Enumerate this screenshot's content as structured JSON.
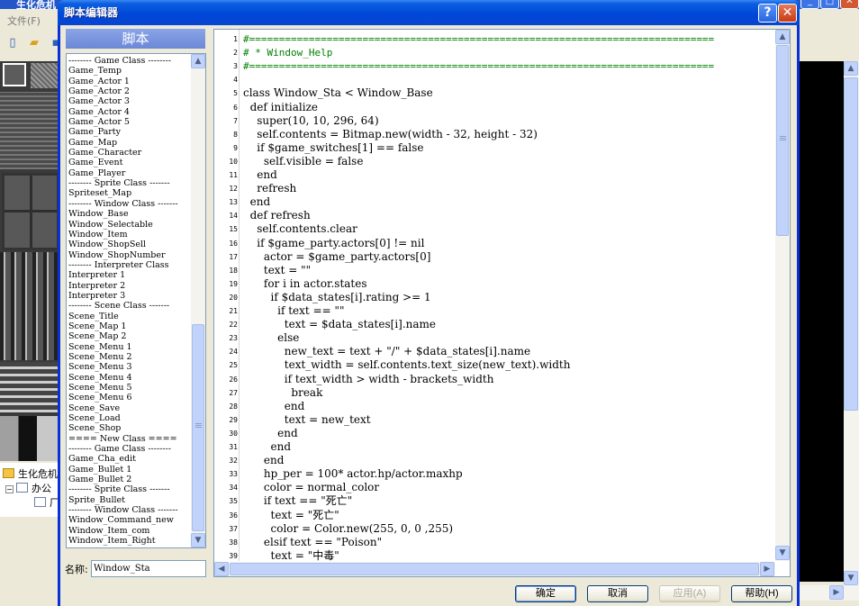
{
  "background_app": {
    "title": "生化危机",
    "menu": "文件(F)",
    "tree": [
      {
        "label": "生化危机"
      },
      {
        "label": "办公"
      },
      {
        "label": "厂"
      }
    ]
  },
  "dialog": {
    "title": "脚本编辑器",
    "help_glyph": "?",
    "close_glyph": "✕"
  },
  "script_panel": {
    "header": "脚本",
    "items": [
      "-------- Game Class --------",
      "Game_Temp",
      "Game_Actor 1",
      "Game_Actor 2",
      "Game_Actor 3",
      "Game_Actor 4",
      "Game_Actor 5",
      "Game_Party",
      "Game_Map",
      "Game_Character",
      "Game_Event",
      "Game_Player",
      "-------- Sprite Class -------",
      "Spriteset_Map",
      "-------- Window Class -------",
      "Window_Base",
      "Window_Selectable",
      "Window_Item",
      "Window_ShopSell",
      "Window_ShopNumber",
      "-------- Interpreter Class",
      "Interpreter 1",
      "Interpreter 2",
      "Interpreter 3",
      "-------- Scene Class -------",
      "Scene_Title",
      "Scene_Map 1",
      "Scene_Map 2",
      "Scene_Menu 1",
      "Scene_Menu 2",
      "Scene_Menu 3",
      "Scene_Menu 4",
      "Scene_Menu 5",
      "Scene_Menu 6",
      "Scene_Save",
      "Scene_Load",
      "Scene_Shop",
      "==== New Class ====",
      "-------- Game Class --------",
      "Game_Cha_edit",
      "Game_Bullet 1",
      "Game_Bullet 2",
      "-------- Sprite Class -------",
      "Sprite_Bullet",
      "-------- Window Class -------",
      "Window_Command_new",
      "Window_Item_com",
      "Window_Item_Right"
    ],
    "name_label": "名称:",
    "name_value": "Window_Sta"
  },
  "editor": {
    "lines": [
      {
        "n": "1",
        "t": "#==============================================================================",
        "c": true
      },
      {
        "n": "2",
        "t": "# * Window_Help",
        "c": true
      },
      {
        "n": "3",
        "t": "#==============================================================================",
        "c": true
      },
      {
        "n": "4",
        "t": ""
      },
      {
        "n": "5",
        "t": "class Window_Sta < Window_Base"
      },
      {
        "n": "6",
        "t": "  def initialize"
      },
      {
        "n": "7",
        "t": "    super(10, 10, 296, 64)"
      },
      {
        "n": "8",
        "t": "    self.contents = Bitmap.new(width - 32, height - 32)"
      },
      {
        "n": "9",
        "t": "    if $game_switches[1] == false"
      },
      {
        "n": "10",
        "t": "      self.visible = false"
      },
      {
        "n": "11",
        "t": "    end"
      },
      {
        "n": "12",
        "t": "    refresh"
      },
      {
        "n": "13",
        "t": "  end"
      },
      {
        "n": "14",
        "t": "  def refresh"
      },
      {
        "n": "15",
        "t": "    self.contents.clear"
      },
      {
        "n": "16",
        "t": "    if $game_party.actors[0] != nil"
      },
      {
        "n": "17",
        "t": "      actor = $game_party.actors[0]"
      },
      {
        "n": "18",
        "t": "      text = \"\""
      },
      {
        "n": "19",
        "t": "      for i in actor.states"
      },
      {
        "n": "20",
        "t": "        if $data_states[i].rating >= 1"
      },
      {
        "n": "21",
        "t": "          if text == \"\""
      },
      {
        "n": "22",
        "t": "            text = $data_states[i].name"
      },
      {
        "n": "23",
        "t": "          else"
      },
      {
        "n": "24",
        "t": "            new_text = text + \"/\" + $data_states[i].name"
      },
      {
        "n": "25",
        "t": "            text_width = self.contents.text_size(new_text).width"
      },
      {
        "n": "26",
        "t": "            if text_width > width - brackets_width"
      },
      {
        "n": "27",
        "t": "              break"
      },
      {
        "n": "28",
        "t": "            end"
      },
      {
        "n": "29",
        "t": "            text = new_text"
      },
      {
        "n": "30",
        "t": "          end"
      },
      {
        "n": "31",
        "t": "        end"
      },
      {
        "n": "32",
        "t": "      end"
      },
      {
        "n": "33",
        "t": "      hp_per = 100* actor.hp/actor.maxhp"
      },
      {
        "n": "34",
        "t": "      color = normal_color"
      },
      {
        "n": "35",
        "t": "      if text == \"死亡\""
      },
      {
        "n": "36",
        "t": "        text = \"死亡\""
      },
      {
        "n": "37",
        "t": "        color = Color.new(255, 0, 0 ,255)"
      },
      {
        "n": "38",
        "t": "      elsif text == \"Poison\""
      },
      {
        "n": "39",
        "t": "        text = \"中毒\""
      }
    ]
  },
  "buttons": {
    "ok": "确定",
    "cancel": "取消",
    "apply": "应用(A)",
    "help": "帮助(H)"
  },
  "colors": {
    "comment": "#008000",
    "title_bar": "#0046d8",
    "list_header": "#7b96e0"
  }
}
